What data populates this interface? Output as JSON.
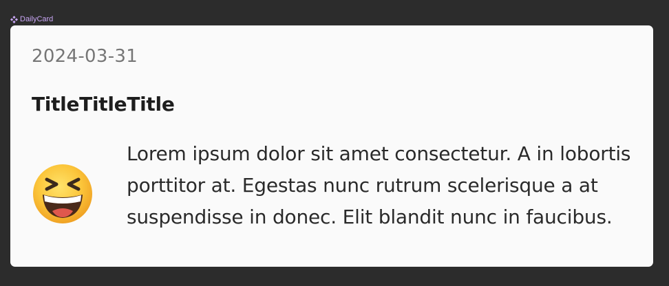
{
  "component_label": {
    "icon": "component-diamond-icon",
    "text": "DailyCard",
    "color": "#c9a6f5"
  },
  "card": {
    "date": "2024-03-31",
    "title": "TitleTitleTitle",
    "emoji": "grinning-squinting-face",
    "body": "Lorem ipsum dolor sit amet consectetur. A in lobortis porttitor at. Egestas nunc rutrum scelerisque a at suspendisse in donec. Elit blandit nunc in faucibus."
  }
}
